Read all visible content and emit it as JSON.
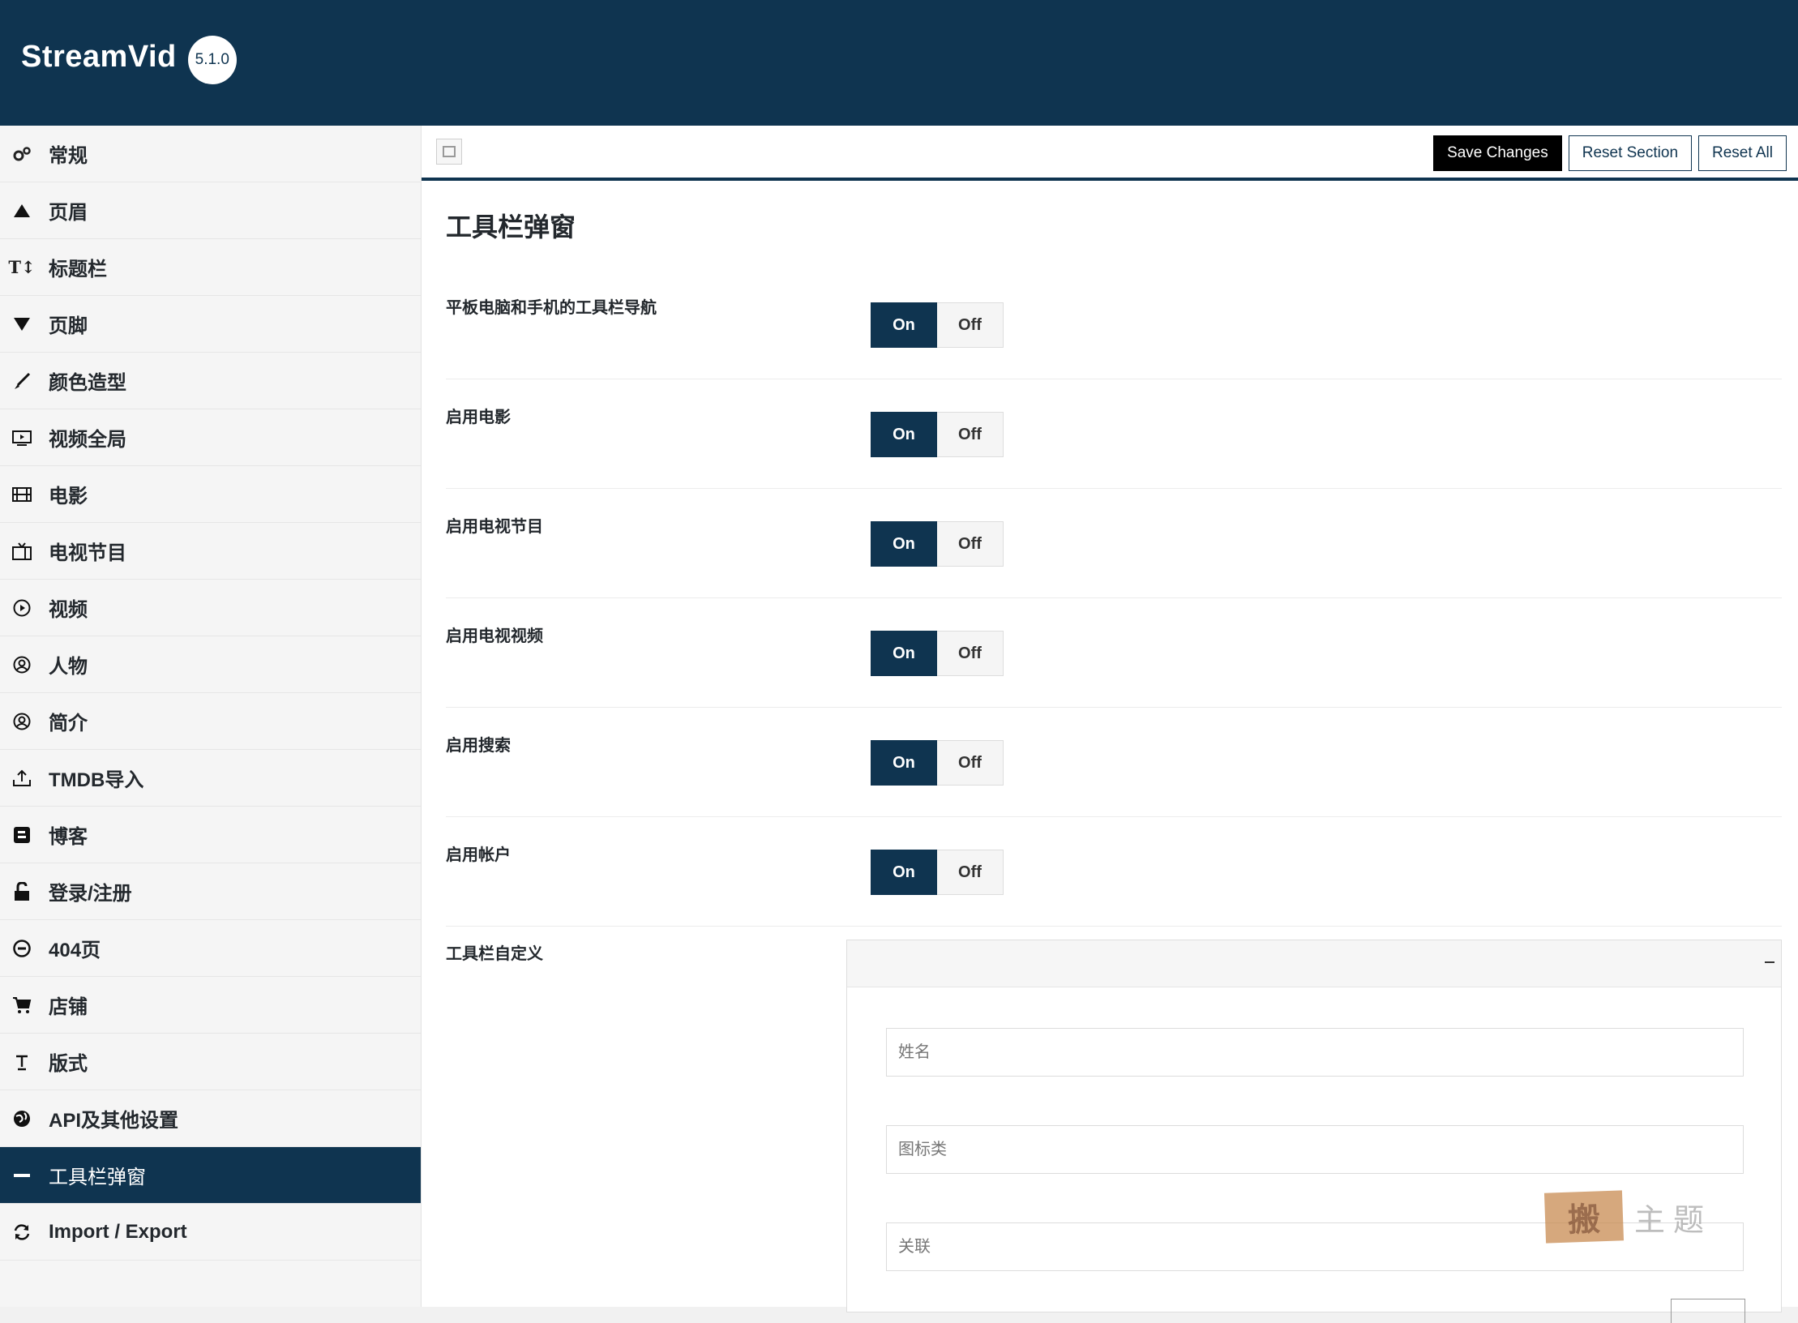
{
  "header": {
    "app_name": "StreamVid",
    "version": "5.1.0"
  },
  "sidebar": {
    "items": [
      {
        "label": "常规",
        "icon": "gears-icon",
        "active": false
      },
      {
        "label": "页眉",
        "icon": "triangle-up-icon",
        "active": false
      },
      {
        "label": "标题栏",
        "icon": "text-height-icon",
        "active": false
      },
      {
        "label": "页脚",
        "icon": "triangle-down-icon",
        "active": false
      },
      {
        "label": "颜色造型",
        "icon": "brush-icon",
        "active": false
      },
      {
        "label": "视频全局",
        "icon": "video-play-icon",
        "active": false
      },
      {
        "label": "电影",
        "icon": "film-icon",
        "active": false
      },
      {
        "label": "电视节目",
        "icon": "tv-icon",
        "active": false
      },
      {
        "label": "视频",
        "icon": "play-circle-icon",
        "active": false
      },
      {
        "label": "人物",
        "icon": "user-circle-icon",
        "active": false
      },
      {
        "label": "简介",
        "icon": "user-circle-icon",
        "active": false
      },
      {
        "label": "TMDB导入",
        "icon": "upload-icon",
        "active": false
      },
      {
        "label": "博客",
        "icon": "blog-icon",
        "active": false
      },
      {
        "label": "登录/注册",
        "icon": "unlock-icon",
        "active": false
      },
      {
        "label": "404页",
        "icon": "minus-circle-icon",
        "active": false
      },
      {
        "label": "店铺",
        "icon": "cart-icon",
        "active": false
      },
      {
        "label": "版式",
        "icon": "text-icon",
        "active": false
      },
      {
        "label": "API及其他设置",
        "icon": "globe-icon",
        "active": false
      },
      {
        "label": "工具栏弹窗",
        "icon": "minus-icon",
        "active": true
      },
      {
        "label": "Import / Export",
        "icon": "refresh-icon",
        "active": false
      }
    ]
  },
  "toolbar": {
    "save_label": "Save Changes",
    "reset_section_label": "Reset Section",
    "reset_all_label": "Reset All"
  },
  "main": {
    "section_title": "工具栏弹窗",
    "fields": [
      {
        "label": "平板电脑和手机的工具栏导航",
        "on": "On",
        "off": "Off"
      },
      {
        "label": "启用电影",
        "on": "On",
        "off": "Off"
      },
      {
        "label": "启用电视节目",
        "on": "On",
        "off": "Off"
      },
      {
        "label": "启用电视视频",
        "on": "On",
        "off": "Off"
      },
      {
        "label": "启用搜索",
        "on": "On",
        "off": "Off"
      },
      {
        "label": "启用帐户",
        "on": "On",
        "off": "Off"
      }
    ],
    "custom_label": "工具栏自定义",
    "repeater": {
      "name_placeholder": "姓名",
      "icon_class_placeholder": "图标类",
      "link_placeholder": "关联"
    }
  },
  "watermark": {
    "seal": "搬",
    "text": "主题",
    "url": "WWW.BANZHUTI.COM"
  },
  "colors": {
    "primary": "#0f3450",
    "save": "#000000"
  }
}
